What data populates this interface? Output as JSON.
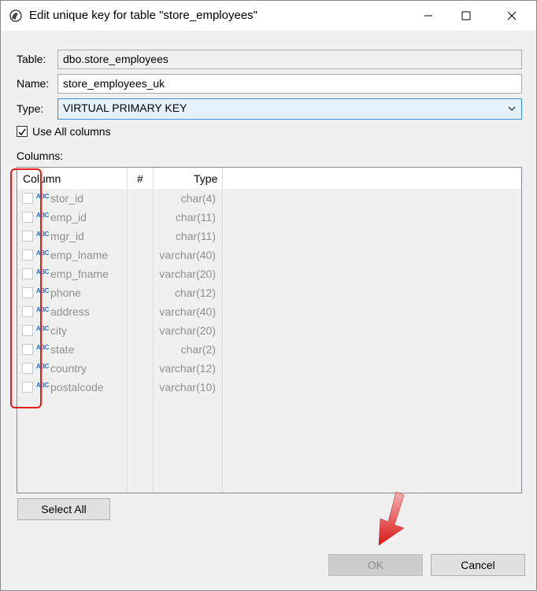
{
  "window": {
    "title": "Edit unique key for table \"store_employees\"",
    "minimize_icon": "minimize-icon",
    "maximize_icon": "maximize-icon",
    "close_icon": "close-icon"
  },
  "form": {
    "table_label": "Table:",
    "table_value": "dbo.store_employees",
    "name_label": "Name:",
    "name_value": "store_employees_uk",
    "type_label": "Type:",
    "type_value": "VIRTUAL PRIMARY KEY",
    "use_all_label": "Use All columns",
    "use_all_checked": true,
    "columns_label": "Columns:"
  },
  "table": {
    "headers": {
      "column": "Column",
      "hash": "#",
      "type": "Type"
    },
    "rows": [
      {
        "name": "stor_id",
        "type": "char(4)"
      },
      {
        "name": "emp_id",
        "type": "char(11)"
      },
      {
        "name": "mgr_id",
        "type": "char(11)"
      },
      {
        "name": "emp_lname",
        "type": "varchar(40)"
      },
      {
        "name": "emp_fname",
        "type": "varchar(20)"
      },
      {
        "name": "phone",
        "type": "char(12)"
      },
      {
        "name": "address",
        "type": "varchar(40)"
      },
      {
        "name": "city",
        "type": "varchar(20)"
      },
      {
        "name": "state",
        "type": "char(2)"
      },
      {
        "name": "country",
        "type": "varchar(12)"
      },
      {
        "name": "postalcode",
        "type": "varchar(10)"
      }
    ],
    "type_icon_text": "ABC"
  },
  "buttons": {
    "select_all": "Select All",
    "ok": "OK",
    "cancel": "Cancel"
  },
  "colors": {
    "highlight": "#e21b1b",
    "accent_border": "#3c8fd6"
  }
}
